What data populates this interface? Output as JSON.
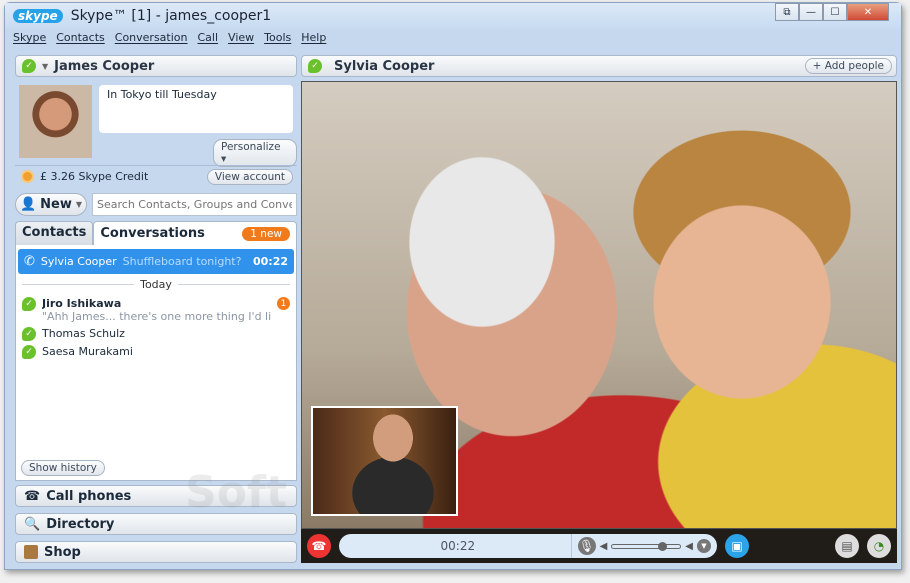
{
  "window": {
    "title": "Skype™ [1] - james_cooper1",
    "logo": "skype"
  },
  "menu": [
    "Skype",
    "Contacts",
    "Conversation",
    "Call",
    "View",
    "Tools",
    "Help"
  ],
  "profile": {
    "name": "James Cooper",
    "mood": "In Tokyo till Tuesday",
    "personalize": "Personalize",
    "credit": "£ 3.26 Skype Credit",
    "view_account": "View account"
  },
  "new_button": "New",
  "search": {
    "placeholder": "Search Contacts, Groups and Conver..."
  },
  "tabs": {
    "contacts": "Contacts",
    "conversations": "Conversations",
    "new_badge": "1 new"
  },
  "active_call": {
    "name": "Sylvia Cooper",
    "message": "Shuffleboard tonight?",
    "duration": "00:22"
  },
  "today_label": "Today",
  "conversations": [
    {
      "name": "Jiro Ishikawa",
      "message": "\"Ahh James... there's one more thing I'd like to ... \"",
      "unread": "1"
    },
    {
      "name": "Thomas Schulz"
    },
    {
      "name": "Saesa Murakami"
    }
  ],
  "show_history": "Show history",
  "nav": {
    "call_phones": "Call phones",
    "directory": "Directory",
    "shop": "Shop"
  },
  "call": {
    "contact": "Sylvia Cooper",
    "add_people": "Add people",
    "timer": "00:22",
    "volume": 0.75
  },
  "watermark": "Soft"
}
